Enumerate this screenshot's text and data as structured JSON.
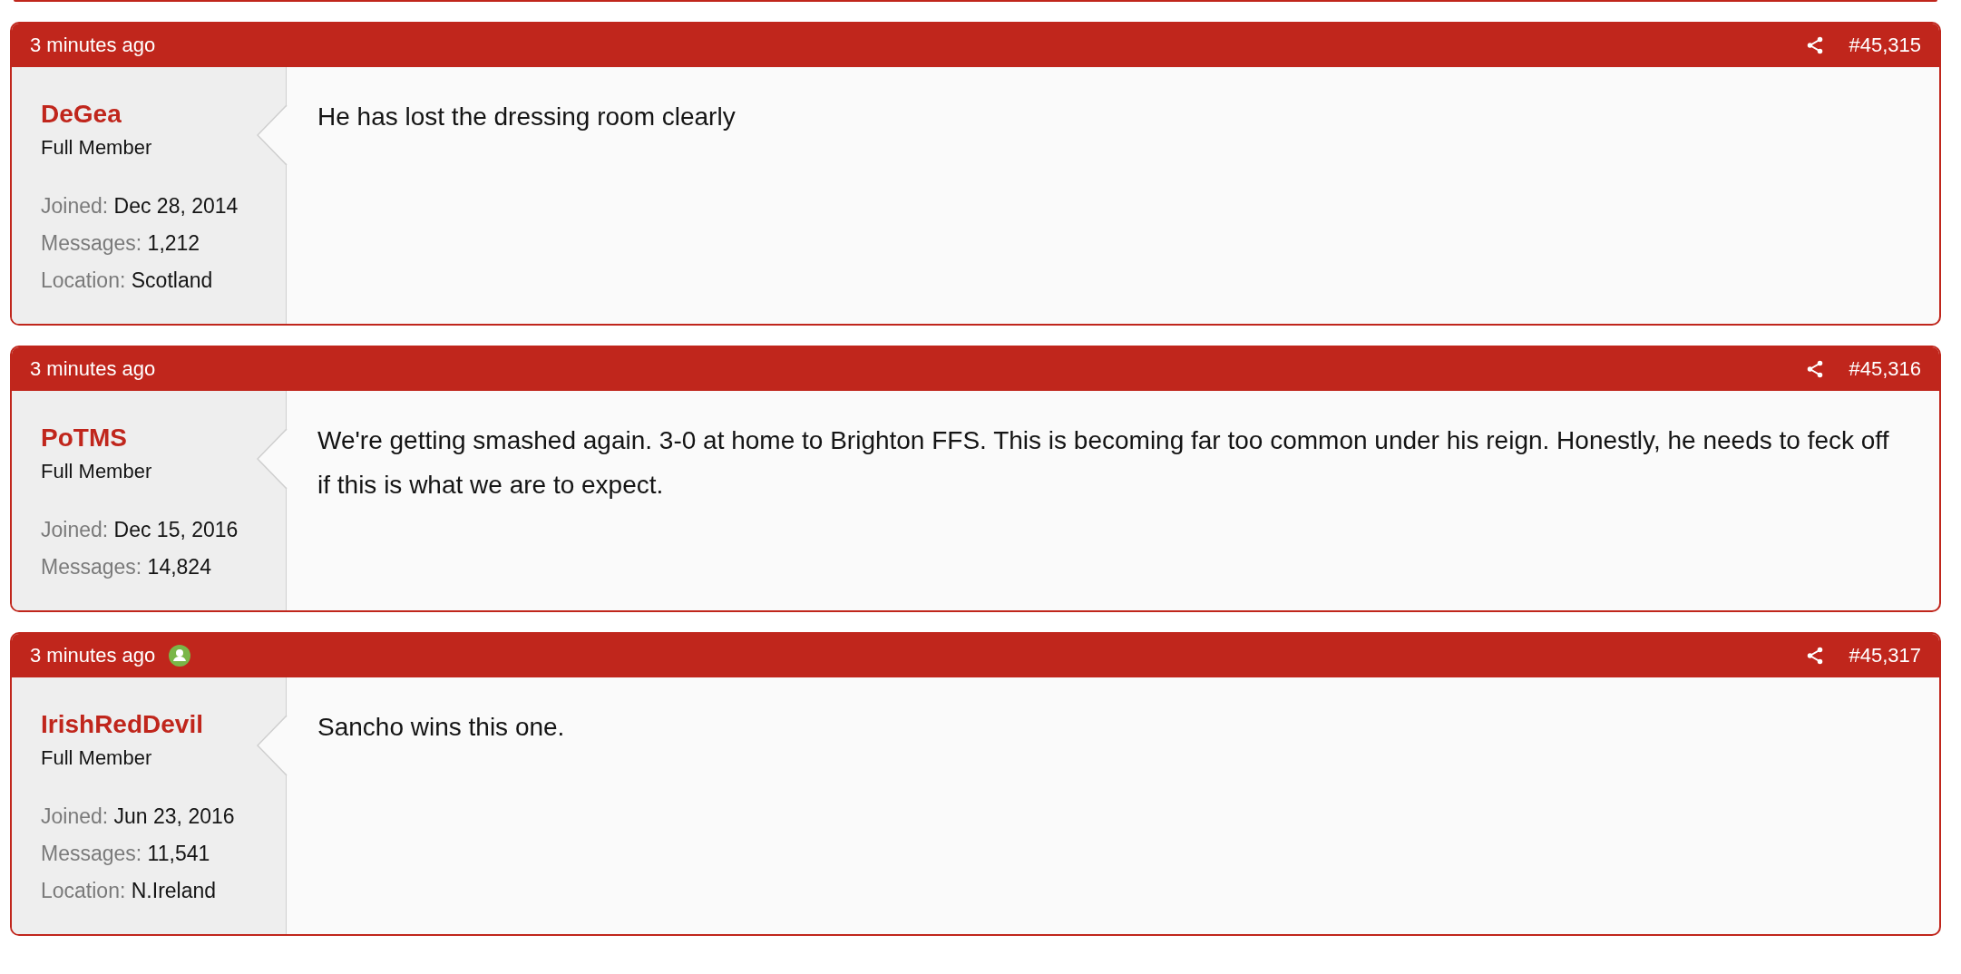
{
  "posts": [
    {
      "time": "3 minutes ago",
      "online": false,
      "number": "#45,315",
      "author": {
        "name": "DeGea",
        "role": "Full Member",
        "info": [
          {
            "label": "Joined:",
            "value": "Dec 28, 2014"
          },
          {
            "label": "Messages:",
            "value": "1,212"
          },
          {
            "label": "Location:",
            "value": "Scotland"
          }
        ]
      },
      "body": "He has lost the dressing room clearly"
    },
    {
      "time": "3 minutes ago",
      "online": false,
      "number": "#45,316",
      "author": {
        "name": "PoTMS",
        "role": "Full Member",
        "info": [
          {
            "label": "Joined:",
            "value": "Dec 15, 2016"
          },
          {
            "label": "Messages:",
            "value": "14,824"
          }
        ]
      },
      "body": "We're getting smashed again. 3-0 at home to Brighton FFS. This is becoming far too common under his reign. Honestly, he needs to feck off if this is what we are to expect."
    },
    {
      "time": "3 minutes ago",
      "online": true,
      "number": "#45,317",
      "author": {
        "name": "IrishRedDevil",
        "role": "Full Member",
        "info": [
          {
            "label": "Joined:",
            "value": "Jun 23, 2016"
          },
          {
            "label": "Messages:",
            "value": "11,541"
          },
          {
            "label": "Location:",
            "value": "N.Ireland"
          }
        ]
      },
      "body": "Sancho wins this one."
    }
  ]
}
